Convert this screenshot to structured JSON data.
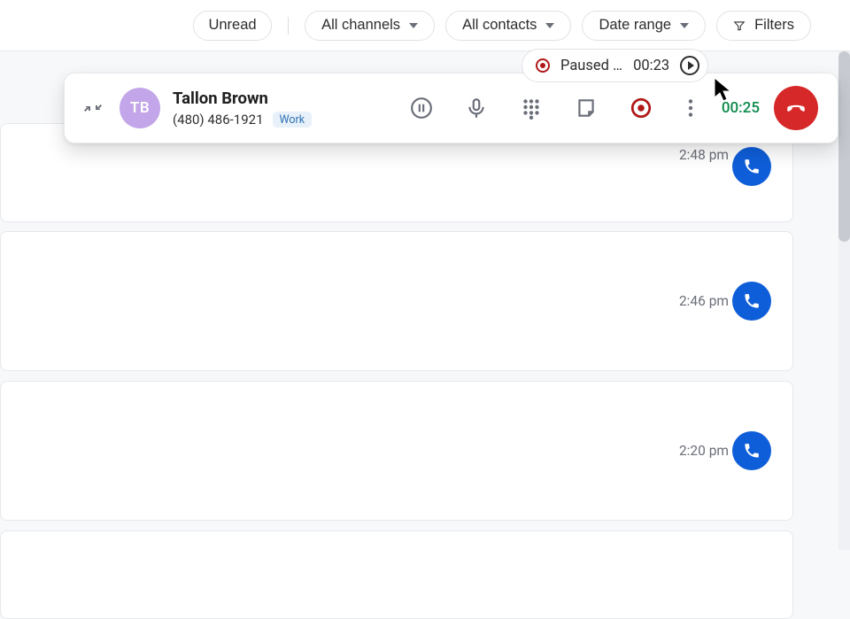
{
  "filterbar": {
    "unread": "Unread",
    "all_channels": "All channels",
    "all_contacts": "All contacts",
    "date_range": "Date range",
    "filters": "Filters"
  },
  "recording": {
    "status": "Paused …",
    "time": "00:23"
  },
  "call": {
    "avatar_initials": "TB",
    "name": "Tallon Brown",
    "phone": "(480) 486-1921",
    "phone_label": "Work",
    "duration": "00:25"
  },
  "cards": [
    {
      "time": "2:48 pm"
    },
    {
      "time": "2:46 pm"
    },
    {
      "time": "2:20 pm"
    }
  ],
  "colors": {
    "accent_blue": "#0f5ed9",
    "hangup_red": "#d62828",
    "record_red": "#b01818",
    "timer_green": "#0b8a4a",
    "avatar_purple": "#c2a6e9"
  }
}
